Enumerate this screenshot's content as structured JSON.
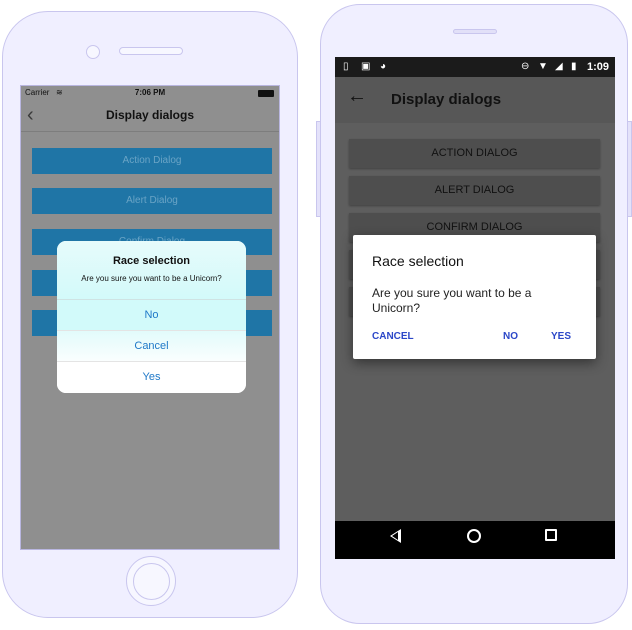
{
  "ios": {
    "status": {
      "carrier": "Carrier",
      "time": "7:06 PM"
    },
    "navbar": {
      "back_icon": "chevron-left-icon",
      "title": "Display dialogs"
    },
    "buttons": [
      "Action Dialog",
      "Alert Dialog",
      "Confirm Dialog",
      "",
      ""
    ],
    "alert": {
      "title": "Race selection",
      "message": "Are you sure you want to be a Unicorn?",
      "actions": [
        "No",
        "Cancel",
        "Yes"
      ]
    }
  },
  "android": {
    "status": {
      "time": "1:09"
    },
    "toolbar": {
      "back_icon": "arrow-left-icon",
      "title": "Display dialogs"
    },
    "buttons": [
      "ACTION DIALOG",
      "ALERT DIALOG",
      "CONFIRM DIALOG",
      "",
      ""
    ],
    "dialog": {
      "title": "Race selection",
      "message": "Are you sure you want to be a Unicorn?",
      "actions": {
        "negative": "CANCEL",
        "neutral": "NO",
        "positive": "YES"
      }
    },
    "navbar": {
      "back_icon": "triangle-back-icon",
      "home_icon": "circle-home-icon",
      "recents_icon": "square-recents-icon"
    }
  }
}
